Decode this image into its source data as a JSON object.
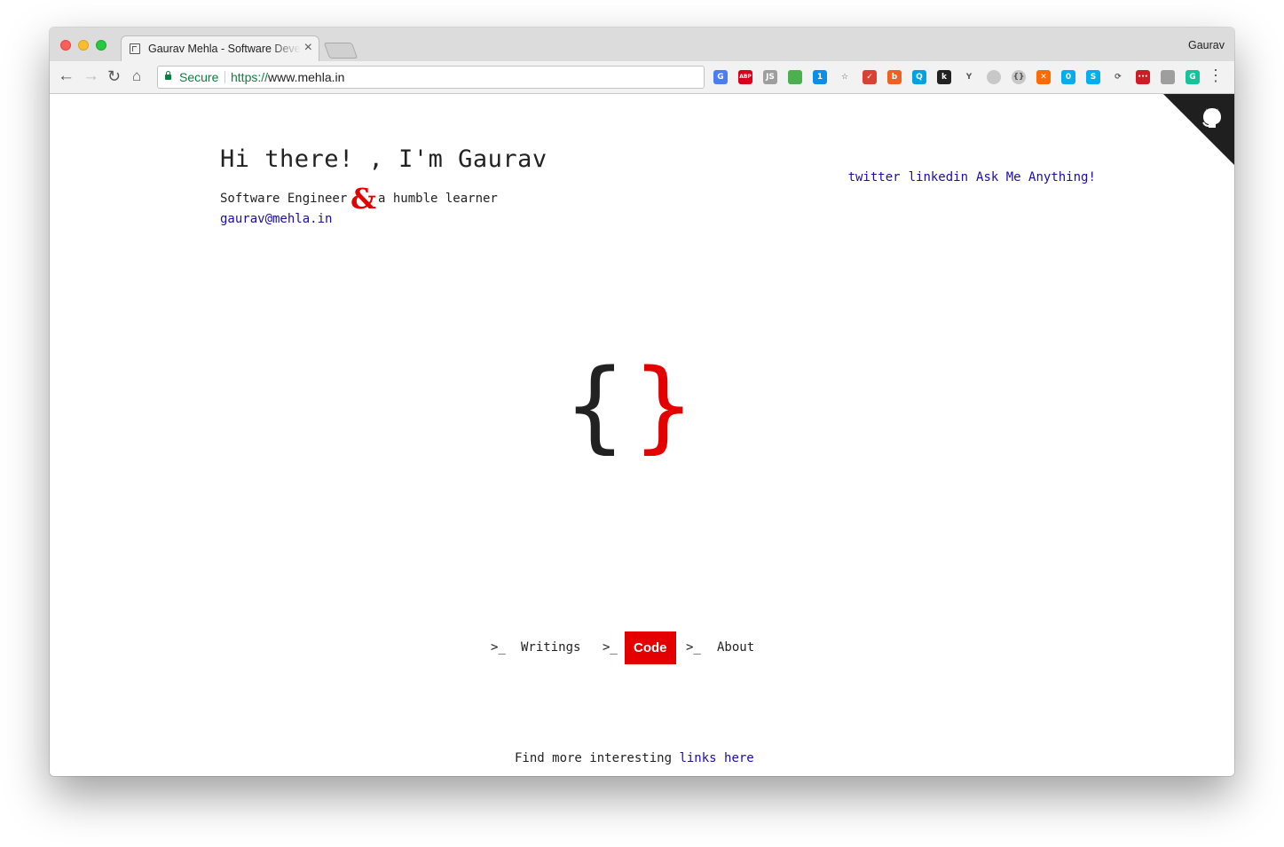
{
  "browser": {
    "tab_title": "Gaurav Mehla - Software Developer",
    "tab_close": "×",
    "profile_name": "Gaurav",
    "secure_label": "Secure",
    "url_scheme": "https://",
    "url_host": "www.mehla.in"
  },
  "extensions": [
    {
      "name": "google-translate-icon",
      "color": "#4a7ef0",
      "label": "G"
    },
    {
      "name": "adblock-plus-icon",
      "color": "#d6001c",
      "label": "ABP"
    },
    {
      "name": "js-tools-icon",
      "color": "#9e9e9e",
      "label": "JS"
    },
    {
      "name": "bookmark-manager-icon",
      "color": "#4caf50",
      "label": ""
    },
    {
      "name": "onepassword-icon",
      "color": "#0c8ee6",
      "label": "1"
    },
    {
      "name": "bookmark-star-icon",
      "color": "#f2f2f2",
      "label": "☆"
    },
    {
      "name": "todoist-icon",
      "color": "#db4035",
      "label": "✓"
    },
    {
      "name": "bitly-icon",
      "color": "#ee6123",
      "label": "b"
    },
    {
      "name": "qwant-icon",
      "color": "#00a3e0",
      "label": "Q"
    },
    {
      "name": "keepa-icon",
      "color": "#222222",
      "label": "k"
    },
    {
      "name": "ycombinator-icon",
      "color": "#f2f2f2",
      "label": "Y"
    },
    {
      "name": "tampermonkey-icon",
      "color": "#c8c8c8",
      "label": ""
    },
    {
      "name": "json-viewer-icon",
      "color": "#c8c8c8",
      "label": "{}"
    },
    {
      "name": "ublock-icon",
      "color": "#ff6a00",
      "label": "✕"
    },
    {
      "name": "ghostery-icon",
      "color": "#00aef0",
      "label": "0"
    },
    {
      "name": "skype-icon",
      "color": "#00aff0",
      "label": "S"
    },
    {
      "name": "sync-icon",
      "color": "#f2f2f2",
      "label": "⟳"
    },
    {
      "name": "lastpass-icon",
      "color": "#cc1d24",
      "label": "•••"
    },
    {
      "name": "clipboard-icon",
      "color": "#9e9e9e",
      "label": ""
    },
    {
      "name": "grammarly-icon",
      "color": "#15c39a",
      "label": "G"
    }
  ],
  "header": {
    "greeting": "Hi there! , I'm Gaurav",
    "tagline_left": "Software Engineer",
    "ampersand": "&",
    "tagline_right": "a humble learner",
    "email": "gaurav@mehla.in"
  },
  "social": {
    "twitter": "twitter",
    "linkedin": "linkedin",
    "ama": "Ask Me Anything!"
  },
  "logo": {
    "left_brace": "{",
    "right_brace": "}",
    "left_color": "#222222",
    "right_color": "#e50000"
  },
  "nav": {
    "prompt": ">_",
    "items": [
      {
        "label": "Writings",
        "active": false
      },
      {
        "label": "Code",
        "active": true
      },
      {
        "label": "About",
        "active": false
      }
    ]
  },
  "footer": {
    "text": "Find more interesting",
    "link": "links here"
  },
  "colors": {
    "accent": "#e50000",
    "link": "#1a0dab",
    "corner": "#1f1f1f"
  }
}
